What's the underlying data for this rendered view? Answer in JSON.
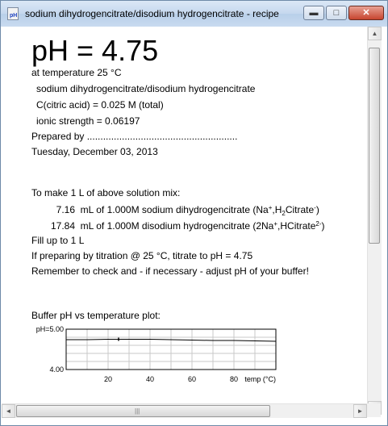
{
  "window": {
    "title": "sodium dihydrogencitrate/disodium hydrogencitrate - recipe",
    "app_icon_text": "pH",
    "minimize_icon": "minimize-icon",
    "maximize_icon": "maximize-icon",
    "close_icon": "close-icon"
  },
  "recipe": {
    "ph_heading": "pH = 4.75",
    "temperature": "at temperature 25 °C",
    "buffer_name": "sodium dihydrogencitrate/disodium hydrogencitrate",
    "concentration": "C(citric acid) = 0.025 M (total)",
    "ionic_strength": "ionic strength = 0.06197",
    "prepared_by": "Prepared by ........................................................",
    "date": "Tuesday, December 03, 2013",
    "make_intro": "To make 1 L of above solution mix:",
    "component1": {
      "amount": "7.16",
      "text": "mL of 1.000M sodium dihydrogencitrate (Na",
      "sup1": "+",
      "mid": ",H",
      "sub": "2",
      "tail": "Citrate",
      "sup2": "-",
      "close": ")"
    },
    "component2": {
      "amount": "17.84",
      "text": "mL of 1.000M disodium hydrogencitrate (2Na",
      "sup1": "+",
      "mid": ",HCitrate",
      "sup2": "2-",
      "close": ")"
    },
    "fill_up": "Fill up to 1 L",
    "titration": "If preparing by titration @ 25 °C, titrate to pH = 4.75",
    "reminder": "Remember to check and - if necessary - adjust pH of your buffer!"
  },
  "plot_title": "Buffer pH vs temperature plot:",
  "chart_data": {
    "type": "line",
    "title": "",
    "xlabel": "temp (°C)",
    "ylabel": "",
    "x_ticks": [
      "20",
      "40",
      "60",
      "80"
    ],
    "y_ticks": [
      "pH=5.00",
      "4.00"
    ],
    "xlim": [
      0,
      100
    ],
    "ylim": [
      4.0,
      5.0
    ],
    "grid": true,
    "series": [
      {
        "x": [
          0,
          10,
          20,
          25,
          30,
          40,
          50,
          60,
          70,
          80,
          90,
          100
        ],
        "y": [
          4.74,
          4.74,
          4.75,
          4.75,
          4.75,
          4.75,
          4.74,
          4.73,
          4.72,
          4.72,
          4.71,
          4.7
        ]
      }
    ],
    "marker": {
      "x": 25,
      "y": 4.75
    }
  },
  "scrollbars": {
    "up_icon": "scroll-up-arrow-icon",
    "down_icon": "scroll-down-arrow-icon",
    "left_icon": "scroll-left-arrow-icon",
    "right_icon": "scroll-right-arrow-icon",
    "up_glyph": "▲",
    "down_glyph": "▼",
    "left_glyph": "◄",
    "right_glyph": "►",
    "grip_glyph": "|||"
  }
}
